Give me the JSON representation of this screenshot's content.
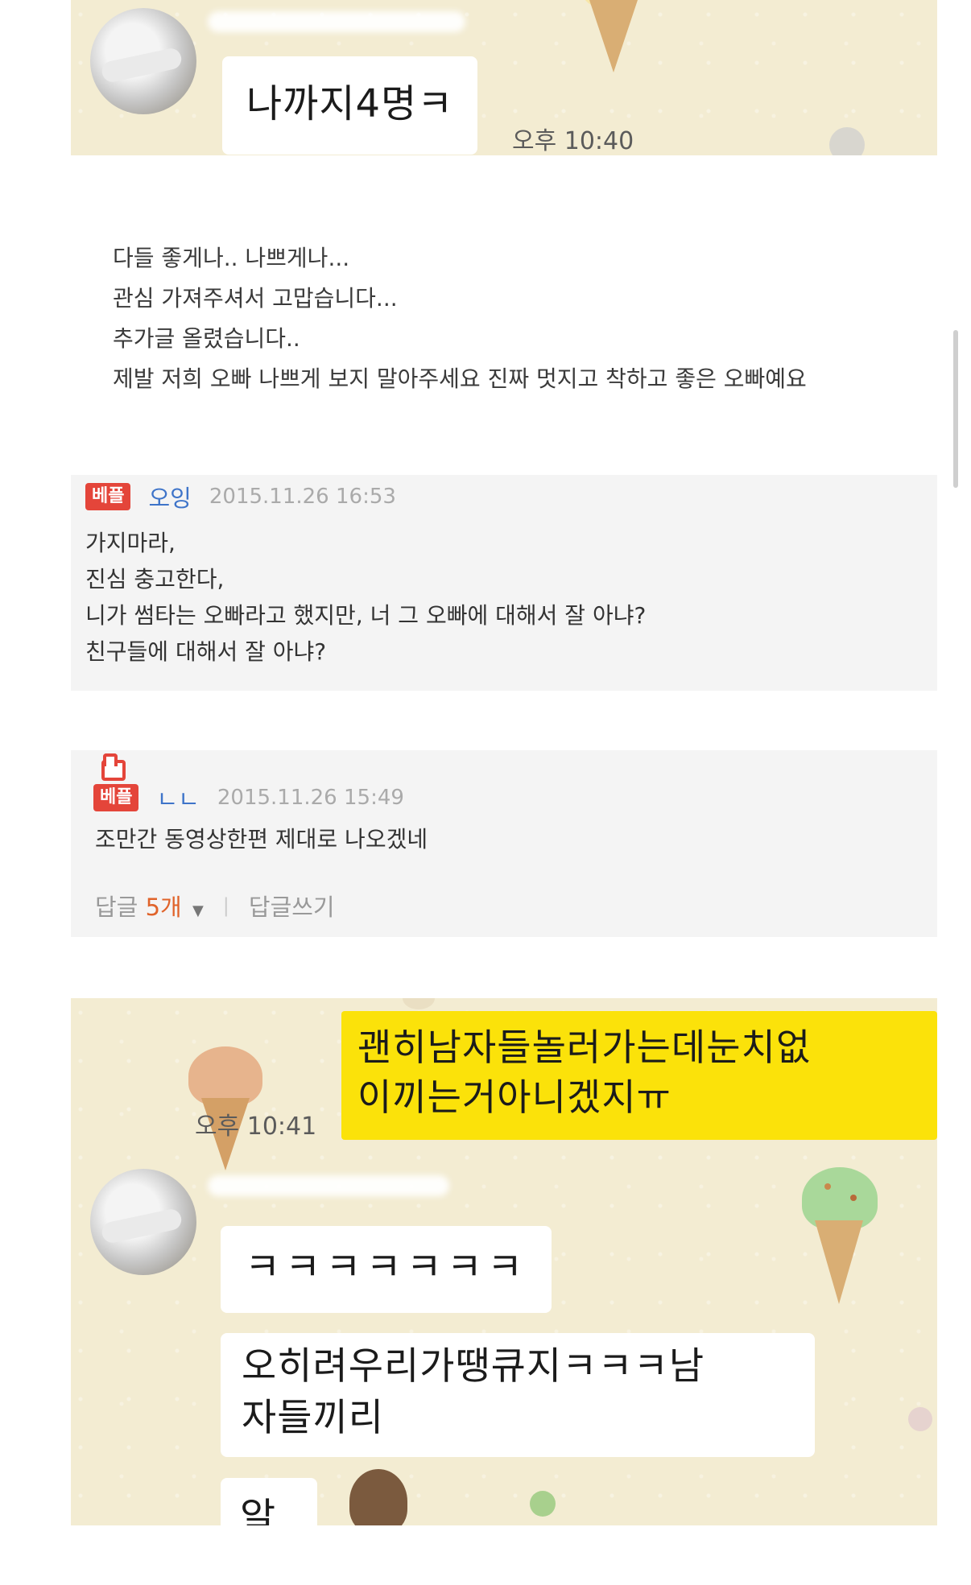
{
  "chat_top": {
    "message": "나까지4명ㅋ",
    "time": "오후 10:40"
  },
  "post": {
    "lines": [
      "다들 좋게나.. 나쁘게나...",
      "관심 가져주셔서 고맙습니다...",
      "추가글 올렸습니다..",
      "제발 저희 오빠 나쁘게 보지 말아주세요 진짜 멋지고 착하고 좋은 오빠예요"
    ]
  },
  "comments": [
    {
      "badge": "베플",
      "author": "오잉",
      "date": "2015.11.26 16:53",
      "lines": [
        "가지마라,",
        "진심 충고한다,",
        "니가 썸타는 오빠라고 했지만, 너 그 오빠에 대해서 잘 아냐?",
        "친구들에 대해서 잘 아냐?"
      ]
    },
    {
      "badge": "베플",
      "author": "ㄴㄴ",
      "date": "2015.11.26 15:49",
      "lines": [
        "조만간 동영상한편 제대로 나오겠네"
      ],
      "reply_label": "답글",
      "reply_count": "5개",
      "write_reply": "답글쓰기"
    }
  ],
  "chat_bottom": {
    "sent_message": "괜히남자들놀러가는데눈치없\n이끼는거아니겠지ㅠ",
    "sent_line1": "괜히남자들놀러가는데눈치없",
    "sent_line2": "이끼는거아니겠지ㅠ",
    "sent_time": "오후 10:41",
    "reply1": "ㅋㅋㅋㅋㅋㅋㅋ",
    "reply2_line1": "오히려우리가땡큐지ㅋㅋㅋ남",
    "reply2_line2": "자들끼리",
    "reply3_partial": "알트"
  },
  "colors": {
    "chat_background": "#f3ecd2",
    "sent_bubble": "#fbe20a",
    "received_bubble": "#ffffff",
    "best_badge": "#e4453a",
    "author": "#3e74c9",
    "reply_count": "#e0632a"
  },
  "icons": [
    "avatar",
    "ice-cream-icon",
    "thumbs-up-icon",
    "chevron-down-icon"
  ]
}
